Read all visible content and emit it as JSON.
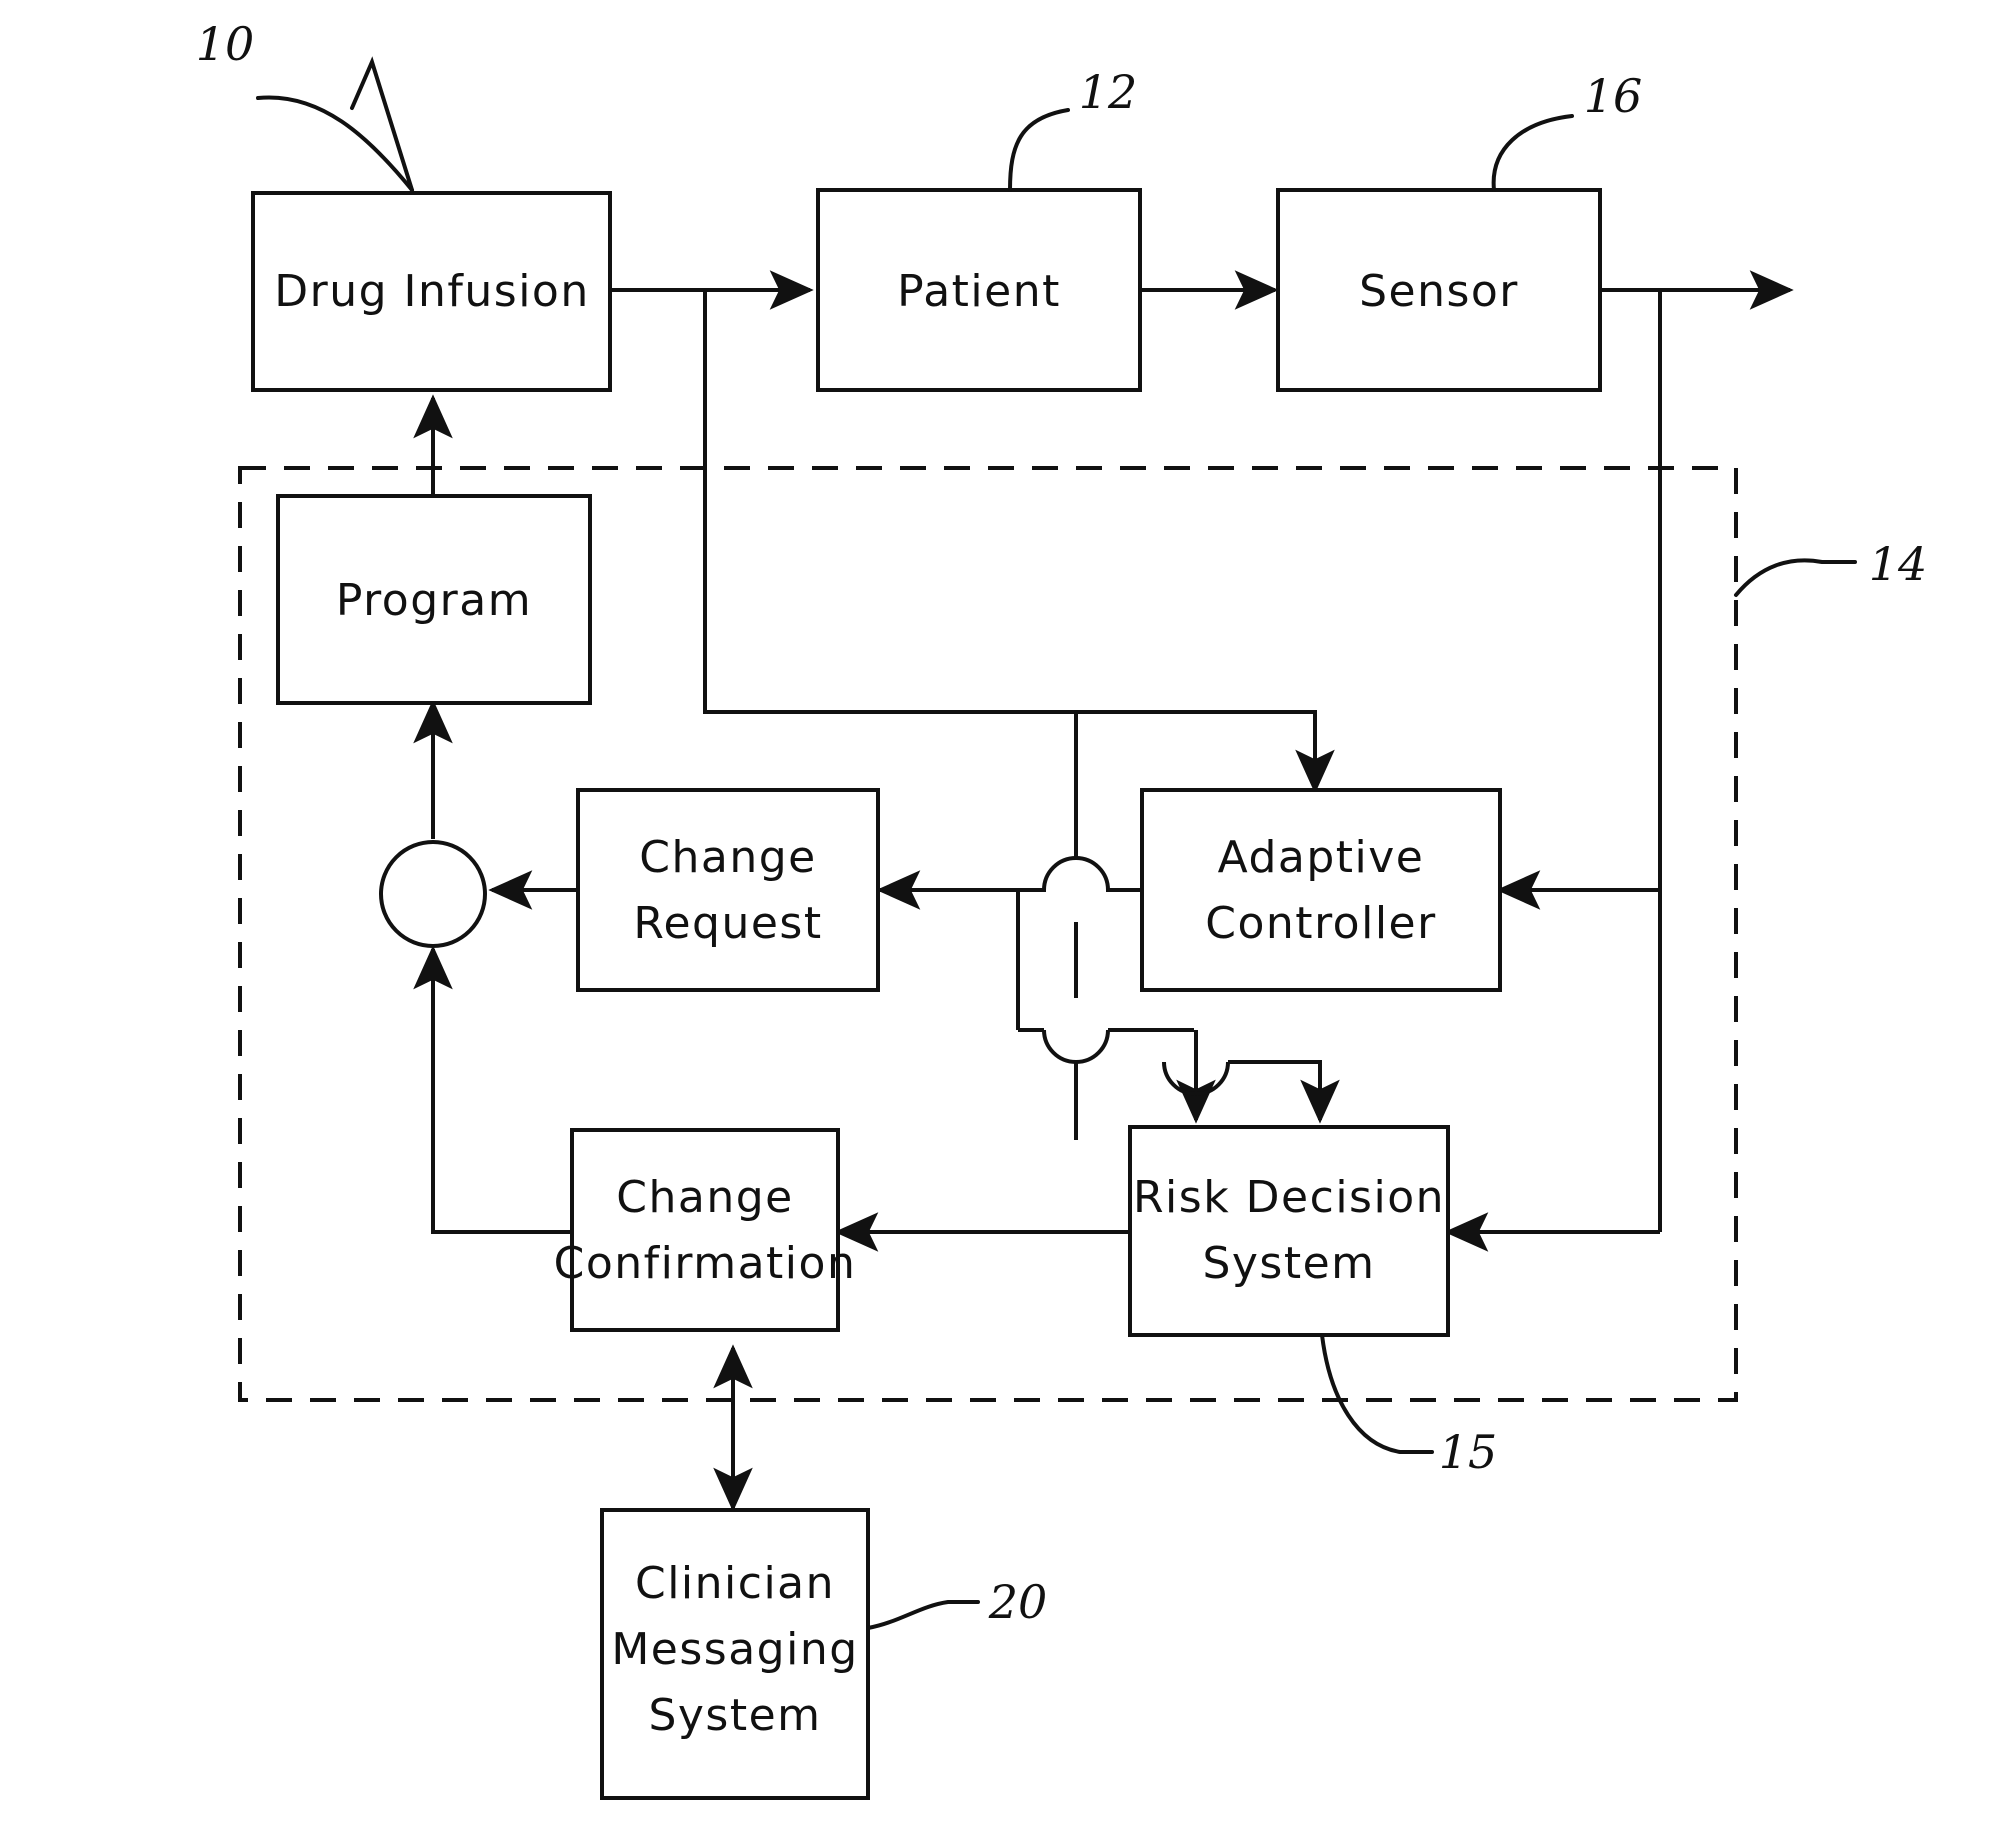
{
  "figure": {
    "title": "Closed-loop drug infusion control block diagram",
    "line_color": "#111111",
    "background": "#ffffff"
  },
  "boxes": {
    "drug_infusion": {
      "label": "Drug  Infusion"
    },
    "patient": {
      "label": "Patient"
    },
    "sensor": {
      "label": "Sensor"
    },
    "program": {
      "label": "Program"
    },
    "change_request": {
      "line1": "Change",
      "line2": "Request"
    },
    "adaptive_controller": {
      "line1": "Adaptive",
      "line2": "Controller"
    },
    "change_confirmation": {
      "line1": "Change",
      "line2": "Confirmation"
    },
    "risk_decision_system": {
      "line1": "Risk  Decision",
      "line2": "System"
    },
    "clinician_messaging_system": {
      "line1": "Clinician",
      "line2": "Messaging",
      "line3": "System"
    }
  },
  "reference_numerals": {
    "system": "10",
    "patient": "12",
    "controller_enclosure": "14",
    "risk_decision": "15",
    "sensor": "16",
    "clinician_messaging": "20"
  }
}
